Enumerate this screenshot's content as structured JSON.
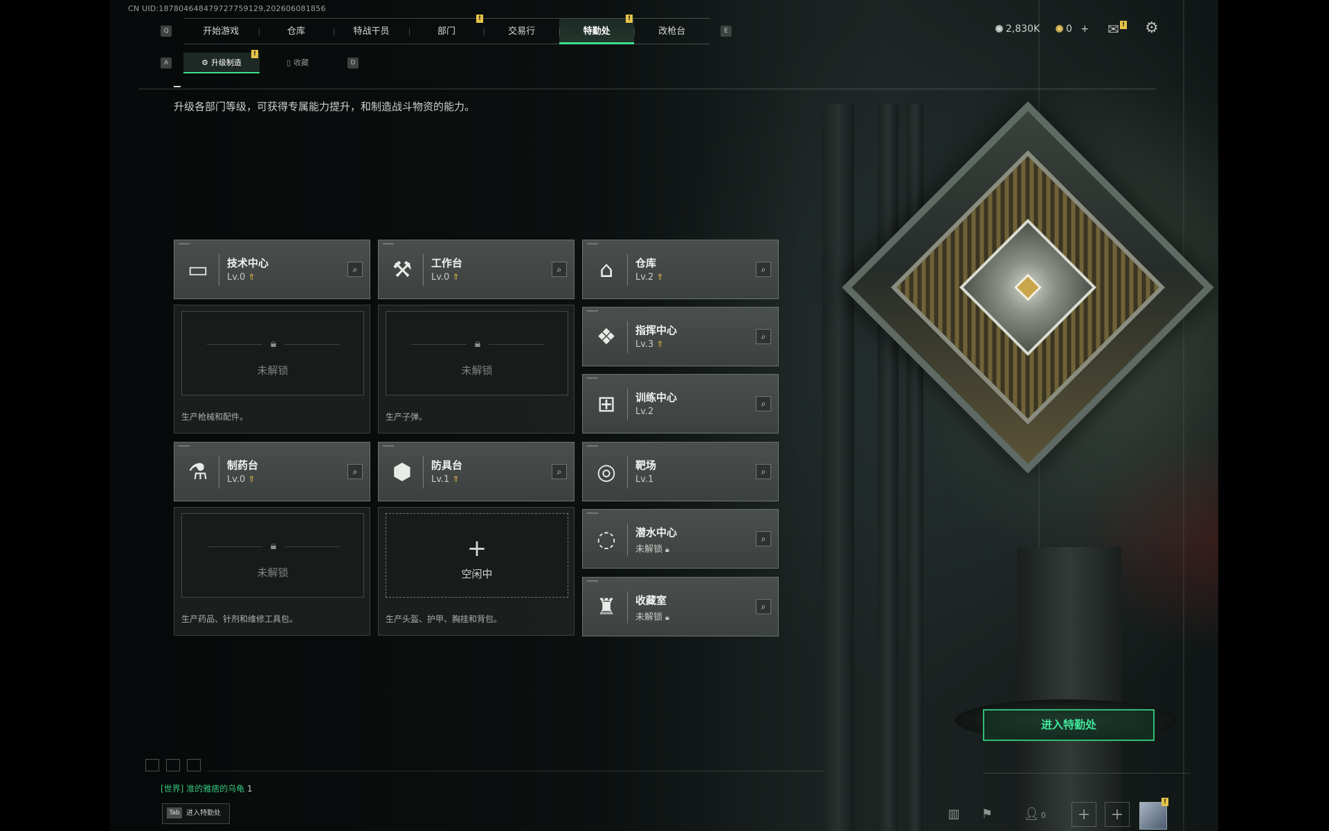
{
  "uid": "CN UID:18780464847972775912​9,202606081856",
  "nav": {
    "key_left": "Q",
    "key_right": "E",
    "items": [
      "开始游戏",
      "仓库",
      "特战干员",
      "部门",
      "交易行",
      "特勤处",
      "改枪台"
    ],
    "active": "特勤处"
  },
  "subnav": {
    "key_left": "A",
    "key_right": "D",
    "items": [
      "升级制造",
      "收藏"
    ],
    "active": "升级制造"
  },
  "header_right": {
    "currency_a": "2,830K",
    "currency_b": "0",
    "plus": "+"
  },
  "description": "升级各部门等级，可获得专属能力提升，和制造战斗物资的能力。",
  "departments": [
    {
      "name": "技术中心",
      "level": "Lv.0",
      "icon": "monitor-icon",
      "upgradable": true
    },
    {
      "name": "工作台",
      "level": "Lv.0",
      "icon": "tools-icon",
      "upgradable": true
    },
    {
      "name": "仓库",
      "level": "Lv.2",
      "icon": "warehouse-icon",
      "upgradable": true
    },
    {
      "name": "指挥中心",
      "level": "Lv.3",
      "icon": "chip-icon",
      "upgradable": true
    },
    {
      "name": "训练中心",
      "level": "Lv.2",
      "icon": "dumbbell-icon",
      "upgradable": false
    },
    {
      "name": "制药台",
      "level": "Lv.0",
      "icon": "microscope-icon",
      "upgradable": true
    },
    {
      "name": "防具台",
      "level": "Lv.1",
      "icon": "hexagon-icon",
      "upgradable": true
    },
    {
      "name": "靶场",
      "level": "Lv.1",
      "icon": "target-icon",
      "upgradable": false
    },
    {
      "name": "潜水中心",
      "level": "未解锁",
      "icon": "diving-mask-icon",
      "upgradable": false,
      "locked": true
    },
    {
      "name": "收藏室",
      "level": "未解锁",
      "icon": "collection-icon",
      "upgradable": false,
      "locked": true
    }
  ],
  "slots": [
    {
      "state": "未解锁",
      "desc": "生产枪械和配件。"
    },
    {
      "state": "未解锁",
      "desc": "生产子弹。"
    },
    {
      "state": "未解锁",
      "desc": "生产药品、针剂和维修工具包。"
    },
    {
      "state": "空闲中",
      "desc": "生产头盔、护甲、胸挂和背包。"
    }
  ],
  "enter_button": "进入特勤处",
  "chat": {
    "channel": "[世界]",
    "message": "准的雅痞的乌龟",
    "count": "1"
  },
  "tab_hint": {
    "key": "Tab",
    "label": "进入特勤处"
  },
  "friends_count": "0",
  "colors": {
    "accent": "#3fe08c",
    "badge": "#e6c34a",
    "upgrade_arrow": "#e1b445"
  }
}
